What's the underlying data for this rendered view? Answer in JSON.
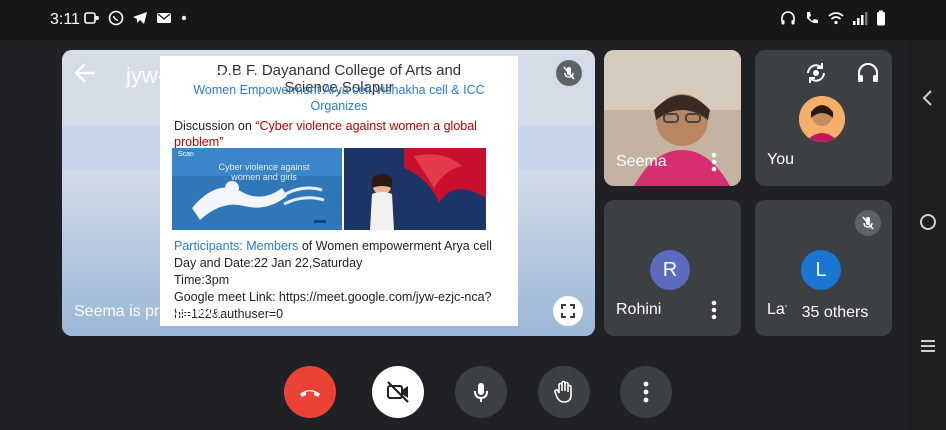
{
  "status_bar": {
    "time": "3:11",
    "left_icons": [
      "screen-record-icon",
      "whatsapp-icon",
      "telegram-icon",
      "gmail-icon",
      "dot-icon"
    ],
    "right_icons": [
      "headphones-icon",
      "call-forward-icon",
      "wifi-icon",
      "signal-icon",
      "battery-icon"
    ]
  },
  "meeting": {
    "code": "jyw-ezjc-nca",
    "presenting_label": "Seema is presenting"
  },
  "slide": {
    "title": "D.B.F. Dayanand College of Arts and Science,Solapur",
    "subtitle": "Women Empowerment Arya cell,Vishakha cell & ICC Organizes",
    "discussion_prefix": "Discussion on ",
    "discussion_topic": "“Cyber violence against women a global problem”",
    "image_caption": "Cyber violence against women and girls",
    "image_brand": "Scan",
    "participants_prefix": "Participants: Members",
    "participants_rest": " of Women empowerment Arya cell",
    "date_line": "Day and Date:22 Jan 22,Saturday",
    "time_line": "Time:3pm",
    "link_line": "Google meet Link: https://meet.google.com/jyw-ezjc-nca?hl=122&authuser=0"
  },
  "participants": {
    "seema": {
      "name": "Seema"
    },
    "you": {
      "name": "You"
    },
    "rohini": {
      "name": "Rohini",
      "initial": "R",
      "color": "#5c6bc0"
    },
    "laxmi": {
      "name": "Laxmi",
      "initial": "L",
      "color": "#1976d2"
    },
    "others_label": "35 others"
  },
  "colors": {
    "end_call": "#ea4335",
    "control_bg": "#3c4043",
    "camera_off_bg": "#ffffff"
  }
}
